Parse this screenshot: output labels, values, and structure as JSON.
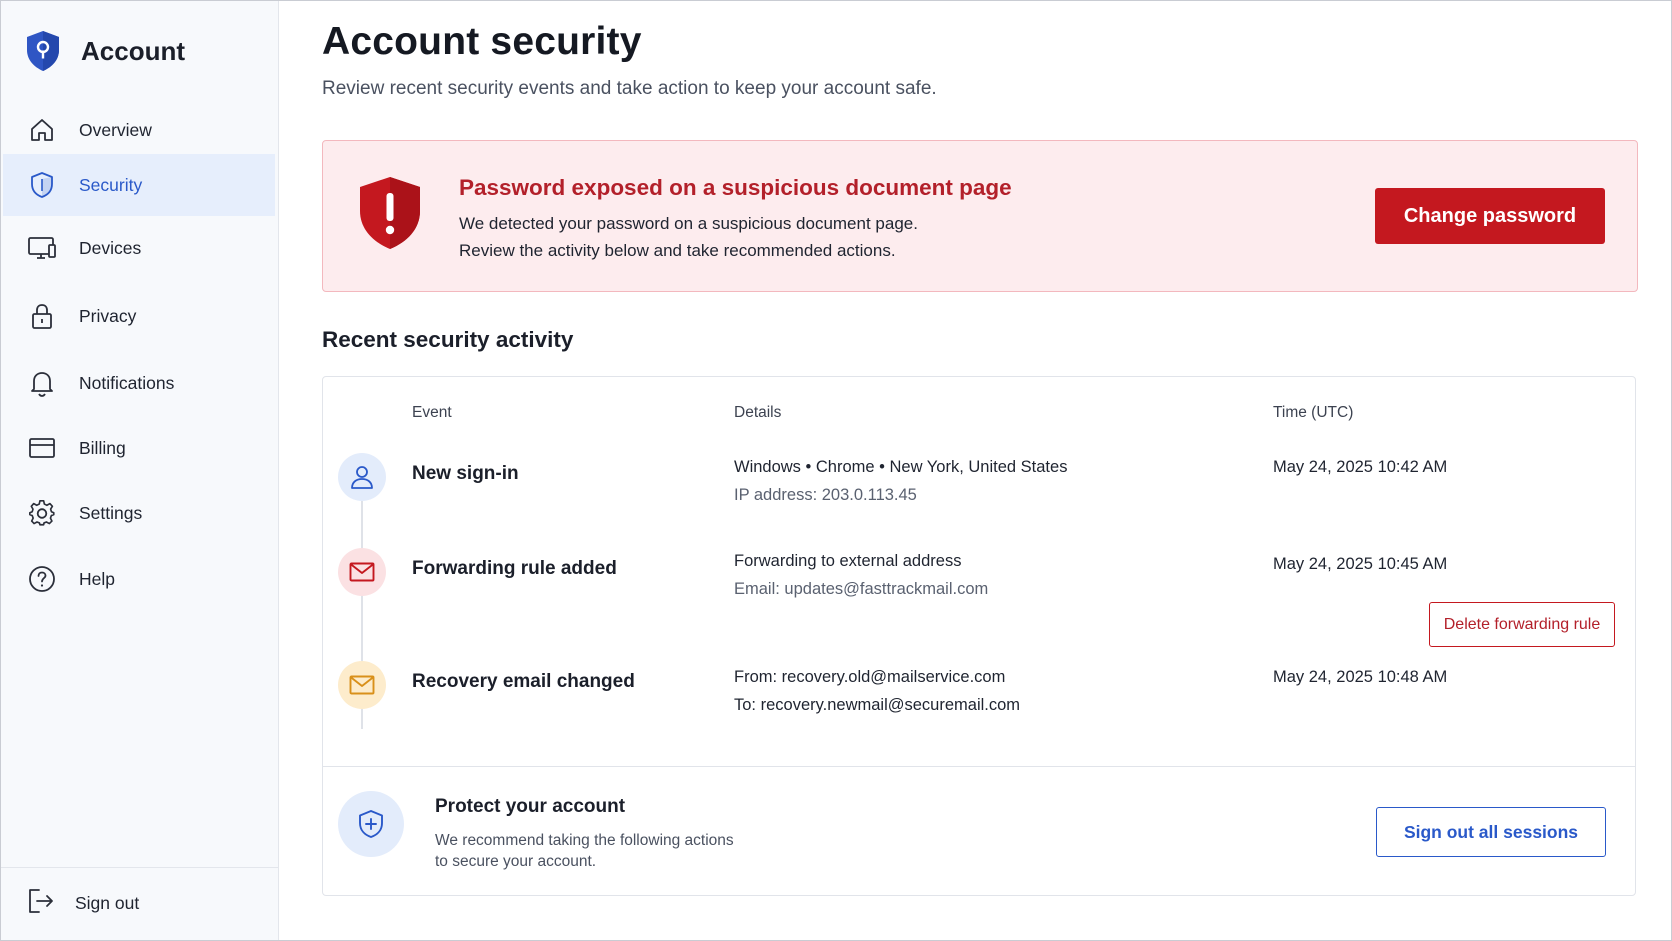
{
  "sidebar": {
    "brand": "Account",
    "items": [
      {
        "label": "Overview",
        "icon": "home-icon",
        "active": false
      },
      {
        "label": "Security",
        "icon": "shield-icon",
        "active": true
      },
      {
        "label": "Devices",
        "icon": "monitor-icon",
        "active": false
      },
      {
        "label": "Privacy",
        "icon": "lock-icon",
        "active": false
      },
      {
        "label": "Notifications",
        "icon": "bell-icon",
        "active": false
      },
      {
        "label": "Billing",
        "icon": "credit-card-icon",
        "active": false
      },
      {
        "label": "Settings",
        "icon": "gear-icon",
        "active": false
      },
      {
        "label": "Help",
        "icon": "help-circle-icon",
        "active": false
      }
    ],
    "sign_out": "Sign out"
  },
  "header": {
    "title": "Account security",
    "subtitle": "Review recent security events and take action to keep your account safe."
  },
  "alert": {
    "title": "Password exposed on a suspicious document page",
    "line1": "We detected your password on a suspicious document page.",
    "line2": "Review the activity below and take recommended actions.",
    "button": "Change password"
  },
  "activity": {
    "title": "Recent security activity",
    "columns": {
      "event": "Event",
      "details": "Details",
      "time": "Time (UTC)"
    },
    "events": [
      {
        "name": "New sign-in",
        "icon": "user-icon",
        "detail_main": "Windows • Chrome • New York, United States",
        "detail_sub": "IP address:  203.0.113.45",
        "time": "May 24, 2025  10:42 AM"
      },
      {
        "name": "Forwarding rule added",
        "icon": "mail-icon",
        "detail_main": "Forwarding to external address",
        "detail_sub": "Email: updates@fasttrackmail.com",
        "time": "May 24, 2025  10:45 AM",
        "action": "Delete forwarding rule"
      },
      {
        "name": "Recovery email changed",
        "icon": "mail-icon",
        "detail_main": "From: recovery.old@mailservice.com",
        "detail_sub": "To:  recovery.newmail@securemail.com",
        "time": "May 24, 2025  10:48 AM"
      }
    ]
  },
  "protect": {
    "title": "Protect your account",
    "line1": "We recommend taking the following actions",
    "line2": "to secure your account.",
    "button": "Sign out all sessions"
  },
  "colors": {
    "accent": "#2a59c9",
    "danger": "#c4181f",
    "alert_bg": "#fdecee",
    "active_nav_bg": "#e6eefc"
  }
}
